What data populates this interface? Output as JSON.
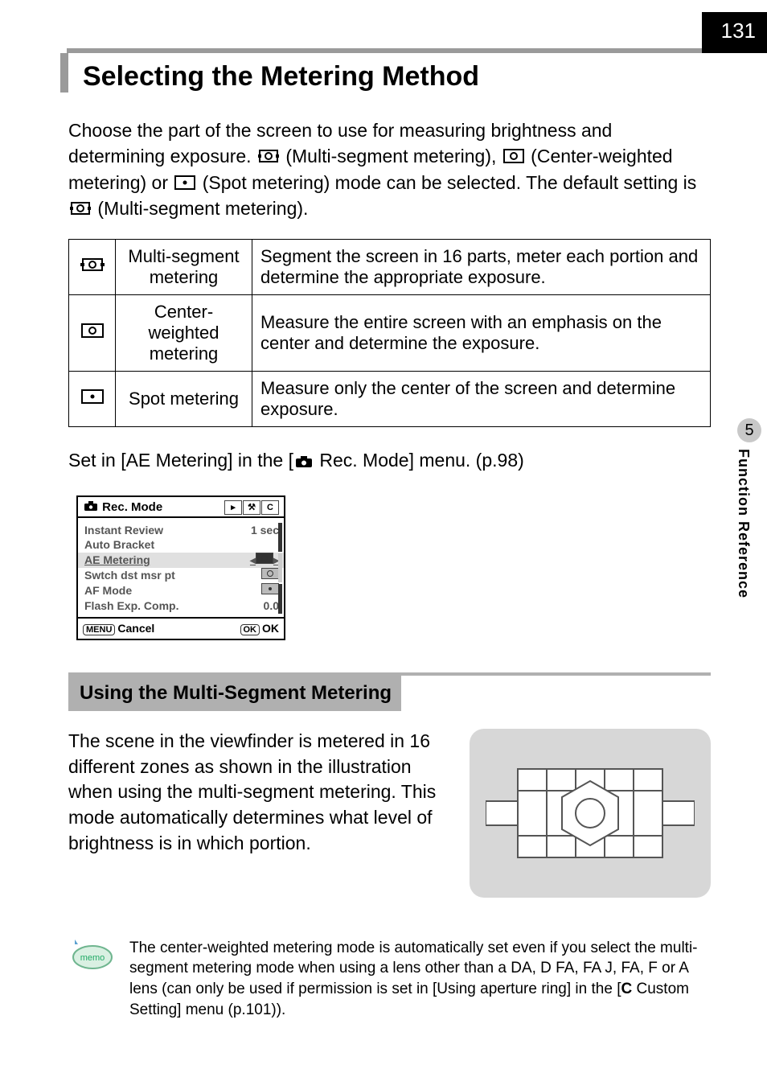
{
  "page_number": "131",
  "sidebar": {
    "chapter_number": "5",
    "chapter_title": "Function Reference"
  },
  "heading1": "Selecting the Metering Method",
  "intro": {
    "p1a": "Choose the part of the screen to use for measuring brightness and determining exposure. ",
    "p1b": " (Multi-segment metering), ",
    "p1c": " (Center-weighted metering) or ",
    "p1d": " (Spot metering) mode can be selected. The default setting is ",
    "p1e": " (Multi-segment metering)."
  },
  "table": {
    "rows": [
      {
        "name": "Multi-segment metering",
        "desc": "Segment the screen in 16 parts, meter each portion and determine the appropriate exposure."
      },
      {
        "name": "Center-weighted metering",
        "desc": "Measure the entire screen with an emphasis on the center and determine the exposure."
      },
      {
        "name": "Spot metering",
        "desc": "Measure only the center of the screen and determine exposure."
      }
    ]
  },
  "set_in": {
    "a": "Set in [AE Metering] in the [",
    "b": " Rec. Mode] menu. (p.98)"
  },
  "lcd": {
    "title": "Rec. Mode",
    "rows": {
      "instant_review": {
        "label": "Instant Review",
        "value": "1 sec"
      },
      "auto_bracket": {
        "label": "Auto Bracket",
        "value": ""
      },
      "ae_metering": {
        "label": "AE Metering"
      },
      "swtch": {
        "label": "Swtch dst msr pt"
      },
      "af_mode": {
        "label": "AF Mode"
      },
      "flash": {
        "label": "Flash Exp. Comp.",
        "value": "0.0"
      }
    },
    "footer": {
      "cancel_badge": "MENU",
      "cancel": "Cancel",
      "ok_badge": "OK",
      "ok": "OK"
    }
  },
  "heading2": "Using the Multi-Segment Metering",
  "multiseg_text": "The scene in the viewfinder is metered in 16 different zones as shown in the illustration when using the multi-segment metering. This mode automatically determines what level of brightness is in which portion.",
  "memo": {
    "badge": "memo",
    "a": "The center-weighted metering mode is automatically set even if you select the multi-segment metering mode when using a lens other than a DA, D FA, FA J, FA, F or A lens (can only be used if permission is set in [Using aperture ring] in the [",
    "b": " Custom Setting] menu (p.101))."
  },
  "icons": {
    "custom_letter": "C"
  }
}
